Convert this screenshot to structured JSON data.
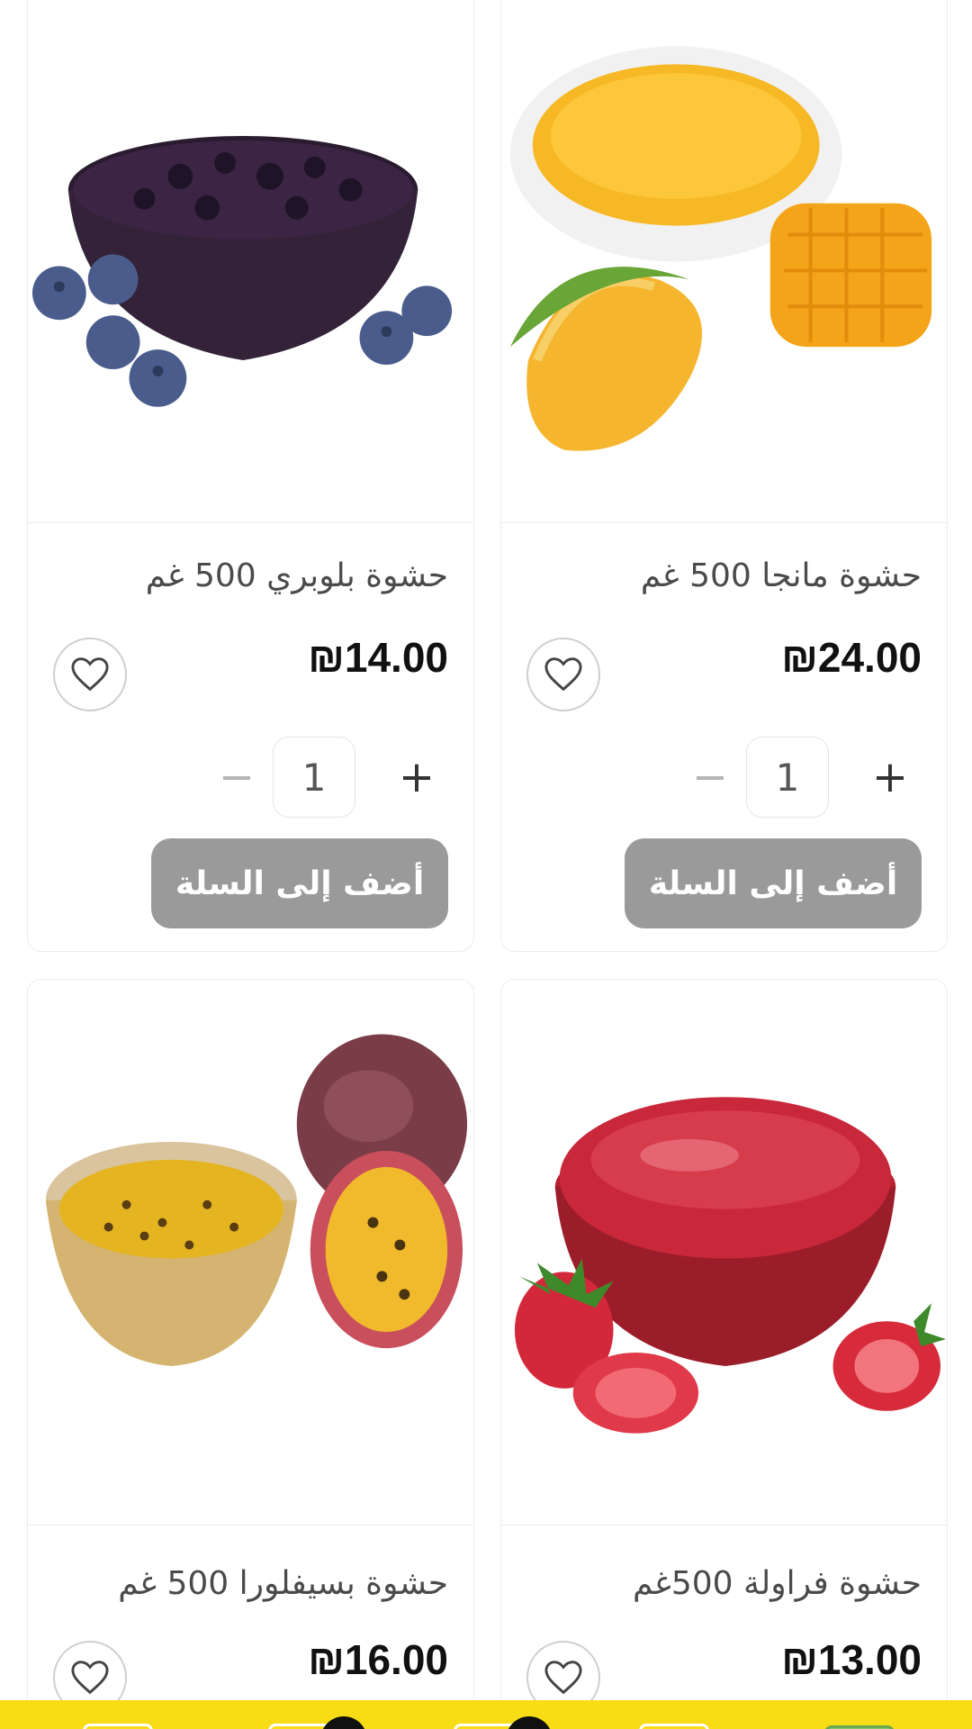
{
  "products": [
    {
      "title": "حشوة بلوبري 500 غم",
      "price": "₪14.00",
      "quantity": "1",
      "add_to_cart": "أضف إلى السلة",
      "image": "blueberry-filling-image"
    },
    {
      "title": "حشوة مانجا 500 غم",
      "price": "₪24.00",
      "quantity": "1",
      "add_to_cart": "أضف إلى السلة",
      "image": "mango-filling-image"
    },
    {
      "title": "حشوة بسيفلورا 500 غم",
      "price": "₪16.00",
      "image": "passionfruit-filling-image"
    },
    {
      "title": "حشوة فراولة 500غم",
      "price": "₪13.00",
      "image": "strawberry-filling-image"
    }
  ],
  "icons": {
    "favorite": "heart-outline-icon",
    "increase": "plus-icon",
    "decrease": "minus-icon"
  },
  "symbols": {
    "plus": "+",
    "minus": "−"
  },
  "colors": {
    "add_button_bg": "#9a9a9a",
    "bottom_bar": "#f7dc16",
    "price_text": "#111111"
  }
}
